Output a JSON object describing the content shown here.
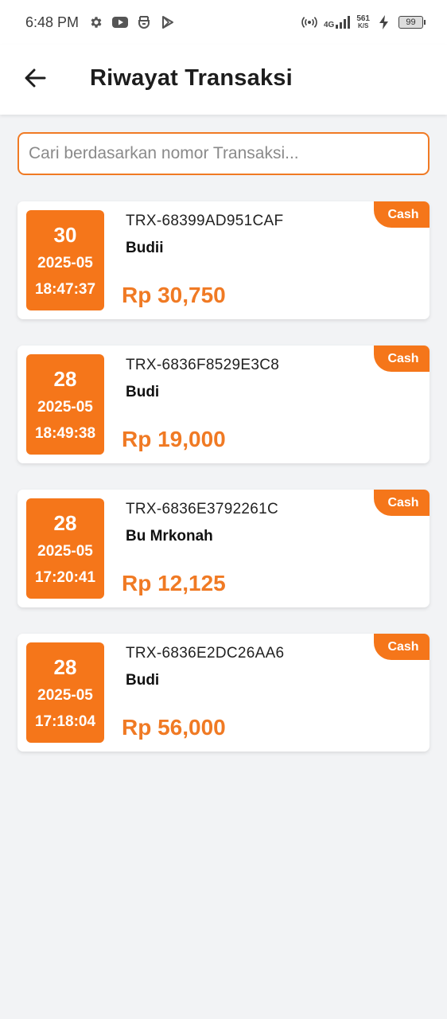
{
  "status_bar": {
    "time": "6:48 PM",
    "network": "4G",
    "speed_value": "561",
    "speed_unit": "K/S",
    "battery": "99",
    "icons": [
      "settings-icon",
      "youtube-icon",
      "app-icon",
      "play-store-icon",
      "hotspot-icon",
      "signal-icon",
      "charging-icon",
      "battery-icon"
    ]
  },
  "header": {
    "title": "Riwayat Transaksi",
    "back_icon": "arrow-left-icon"
  },
  "search": {
    "placeholder": "Cari berdasarkan nomor Transaksi...",
    "value": ""
  },
  "colors": {
    "accent": "#f5761a",
    "amount": "#f07a24",
    "background": "#f2f3f5"
  },
  "transactions": [
    {
      "day": "30",
      "year_month": "2025-05",
      "time": "18:47:37",
      "id": "TRX-68399AD951CAF",
      "customer": "Budii",
      "amount": "Rp 30,750",
      "payment": "Cash"
    },
    {
      "day": "28",
      "year_month": "2025-05",
      "time": "18:49:38",
      "id": "TRX-6836F8529E3C8",
      "customer": "Budi",
      "amount": "Rp 19,000",
      "payment": "Cash"
    },
    {
      "day": "28",
      "year_month": "2025-05",
      "time": "17:20:41",
      "id": "TRX-6836E3792261C",
      "customer": "Bu Mrkonah",
      "amount": "Rp 12,125",
      "payment": "Cash"
    },
    {
      "day": "28",
      "year_month": "2025-05",
      "time": "17:18:04",
      "id": "TRX-6836E2DC26AA6",
      "customer": "Budi",
      "amount": "Rp 56,000",
      "payment": "Cash"
    }
  ]
}
